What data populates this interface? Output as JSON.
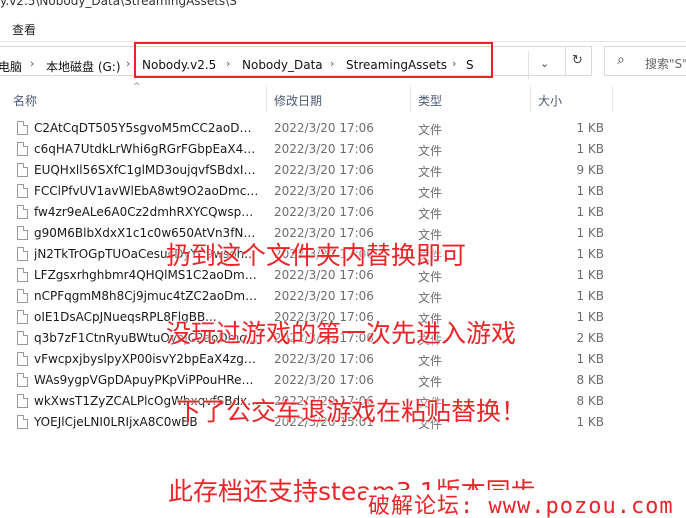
{
  "window": {
    "title": "y.v2.5\\Nobody_Data\\StreamingAssets\\S"
  },
  "ribbon": {
    "view_tab": "查看"
  },
  "address": {
    "breadcrumbs": [
      "电脑",
      "本地磁盘 (G:)",
      "Nobody.v2.5",
      "Nobody_Data",
      "StreamingAssets",
      "S"
    ],
    "separator": "›",
    "dropdown": "⌄",
    "refresh": "↻",
    "highlight_color": "#e8262a"
  },
  "search": {
    "placeholder": "搜索\"S\"",
    "icon": "search-icon"
  },
  "columns": {
    "name": "名称",
    "date": "修改日期",
    "type": "类型",
    "size": "大小",
    "sort_indicator": "^"
  },
  "files": [
    {
      "name": "C2AtCqDT505Y5sgvoM5mCC2aoDmc...",
      "date": "2022/3/20 17:06",
      "type": "文件",
      "size": "1 KB"
    },
    {
      "name": "c6qHA7UtdkLrWhi6gRGrFGbpEaX4zg...",
      "date": "2022/3/20 17:06",
      "type": "文件",
      "size": "1 KB"
    },
    {
      "name": "EUQHxll56SXfC1glMD3oujqvfSBdxIbi...",
      "date": "2022/3/20 17:06",
      "type": "文件",
      "size": "9 KB"
    },
    {
      "name": "FCClPfvUV1avWlEbA8wt9O2aoDmcnl...",
      "date": "2022/3/20 17:06",
      "type": "文件",
      "size": "1 KB"
    },
    {
      "name": "fw4zr9eALe6A0Cz2dmhRXYCQwsphg...",
      "date": "2022/3/20 17:06",
      "type": "文件",
      "size": "1 KB"
    },
    {
      "name": "g90M6BlbXdxX1c1c0w650AtVn3fNos...",
      "date": "2022/3/20 17:06",
      "type": "文件",
      "size": "1 KB"
    },
    {
      "name": "jN2TkTrOGpTUOaCesucDyYC9wsoh...",
      "date": "2022/3/20 17:06",
      "type": "文件",
      "size": "1 KB"
    },
    {
      "name": "LFZgsxrhghbmr4QHQlMS1C2aoDmc...",
      "date": "2022/3/20 17:06",
      "type": "文件",
      "size": "1 KB"
    },
    {
      "name": "nCPFqgmM8h8Cj9jmuc4tZC2aoDmcnl...",
      "date": "2022/3/20 17:06",
      "type": "文件",
      "size": "1 KB"
    },
    {
      "name": "oIE1DsACpJNueqsRPL8FlgBB...",
      "date": "2022/3/20 17:06",
      "type": "文件",
      "size": "1 KB"
    },
    {
      "name": "q3b7zF1CtnRyuBWtuOyajC2aoDmcnl...",
      "date": "2022/3/20 17:06",
      "type": "文件",
      "size": "2 KB"
    },
    {
      "name": "vFwcpxjbyslpyXP00isvY2bpEaX4zgue...",
      "date": "2022/3/20 17:06",
      "type": "文件",
      "size": "1 KB"
    },
    {
      "name": "WAs9ygpVGpDApuyPKpViPPouHReX...",
      "date": "2022/3/20 17:06",
      "type": "文件",
      "size": "8 KB"
    },
    {
      "name": "wkXwsT1ZyZCALPlcOgWbxqvfSBdxIb...",
      "date": "2022/3/20 17:06",
      "type": "文件",
      "size": "8 KB"
    },
    {
      "name": "YOEJlCjeLNI0LRIjxA8C0wBB",
      "date": "2022/3/20 15:01",
      "type": "文件",
      "size": "1 KB"
    }
  ],
  "overlay": {
    "line1": "扔到这个文件夹内替换即可",
    "line2": "没玩过游戏的第一次先进入游戏",
    "line3": "下了公交车退游戏在粘贴替换！",
    "line4": "此存档还支持steam3.1版本同步",
    "watermark": "破解论坛: www.pozou.com",
    "color": "#e8262a"
  }
}
